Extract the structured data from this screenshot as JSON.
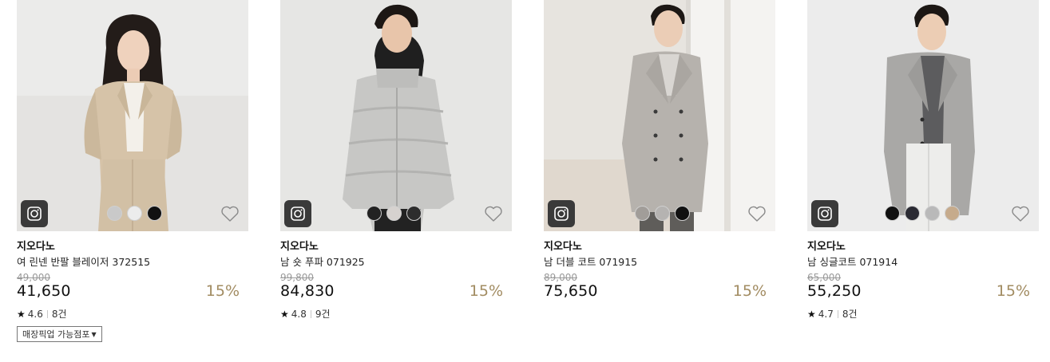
{
  "products": [
    {
      "brand": "지오다노",
      "name": "여 린넨 반팔 블레이저 372515",
      "original_price": "49,000",
      "price": "41,650",
      "discount": "15%",
      "rating": "4.6",
      "reviews": "8건",
      "pickup_label": "매장픽업 가능점포",
      "swatch_colors": [
        "#c9c9c9",
        "#ececec",
        "#111111"
      ]
    },
    {
      "brand": "지오다노",
      "name": "남 숏 푸파 071925",
      "original_price": "99,800",
      "price": "84,830",
      "discount": "15%",
      "rating": "4.8",
      "reviews": "9건",
      "swatch_colors": [
        "#222222",
        "#d6d2cf",
        "#2d2d2d"
      ]
    },
    {
      "brand": "지오다노",
      "name": "남 더블 코트 071915",
      "original_price": "89,000",
      "price": "75,650",
      "discount": "15%",
      "swatch_colors": [
        "#a19d99",
        "#b5b3b1",
        "#111111"
      ]
    },
    {
      "brand": "지오다노",
      "name": "남 싱글코트 071914",
      "original_price": "65,000",
      "price": "55,250",
      "discount": "15%",
      "rating": "4.7",
      "reviews": "8건",
      "swatch_colors": [
        "#111111",
        "#2b2b33",
        "#b9b9b9",
        "#c6ab8c"
      ]
    }
  ],
  "colors": {
    "discount": "#a28c62",
    "insta_button": "#3a3a3a"
  },
  "icons": {
    "insta": "instagram-icon",
    "wishlist": "heart-outline-icon",
    "rating": "star-icon",
    "dropdown": "caret-down-icon"
  }
}
